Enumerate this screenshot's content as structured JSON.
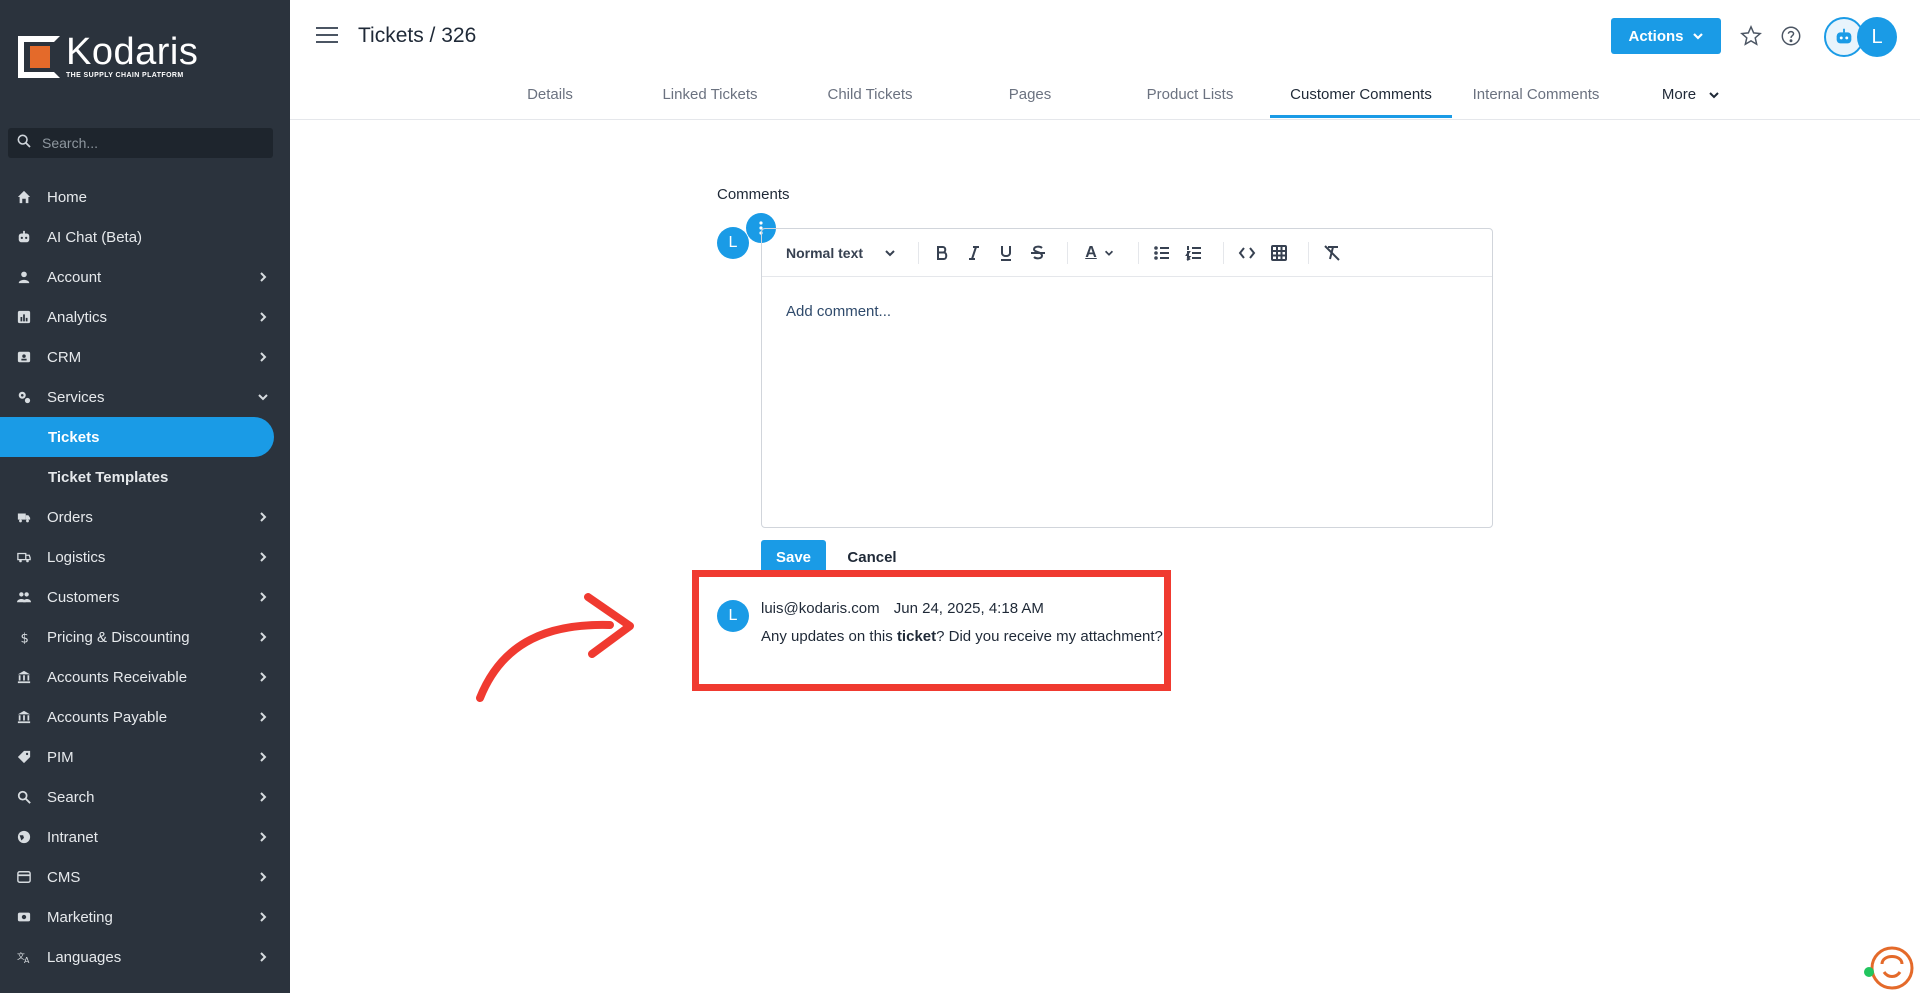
{
  "sidebar": {
    "brand_name": "Kodaris",
    "brand_tagline": "THE SUPPLY CHAIN PLATFORM",
    "search_placeholder": "Search...",
    "items": [
      {
        "label": "Home",
        "icon": "home-icon"
      },
      {
        "label": "AI Chat (Beta)",
        "icon": "robot-icon"
      },
      {
        "label": "Account",
        "icon": "user-icon"
      },
      {
        "label": "Analytics",
        "icon": "analytics-icon"
      },
      {
        "label": "CRM",
        "icon": "contact-card-icon"
      },
      {
        "label": "Services",
        "icon": "services-icon"
      }
    ],
    "services_sub": [
      "Tickets",
      "Ticket Templates"
    ],
    "items_after": [
      {
        "label": "Orders",
        "icon": "truck-icon"
      },
      {
        "label": "Logistics",
        "icon": "shipping-icon"
      },
      {
        "label": "Customers",
        "icon": "people-icon"
      },
      {
        "label": "Pricing & Discounting",
        "icon": "dollar-icon"
      },
      {
        "label": "Accounts Receivable",
        "icon": "bank-icon"
      },
      {
        "label": "Accounts Payable",
        "icon": "bank-icon"
      },
      {
        "label": "PIM",
        "icon": "tag-icon"
      },
      {
        "label": "Search",
        "icon": "search-icon"
      },
      {
        "label": "Intranet",
        "icon": "globe-icon"
      },
      {
        "label": "CMS",
        "icon": "cms-icon"
      },
      {
        "label": "Marketing",
        "icon": "megaphone-icon"
      },
      {
        "label": "Languages",
        "icon": "translate-icon"
      }
    ]
  },
  "header": {
    "title": "Tickets / 326",
    "actions_label": "Actions",
    "user_initial": "L"
  },
  "tabs": [
    {
      "label": "Details"
    },
    {
      "label": "Linked Tickets"
    },
    {
      "label": "Child Tickets"
    },
    {
      "label": "Pages"
    },
    {
      "label": "Product Lists"
    },
    {
      "label": "Customer Comments"
    },
    {
      "label": "Internal Comments"
    },
    {
      "label": "More"
    }
  ],
  "comments": {
    "section_label": "Comments",
    "avatar_initial": "L",
    "editor": {
      "format_label": "Normal text",
      "placeholder": "Add comment...",
      "text_color_glyph": "A"
    },
    "save_label": "Save",
    "cancel_label": "Cancel",
    "entry": {
      "author": "luis@kodaris.com",
      "date": "Jun 24, 2025, 4:18 AM",
      "text_before": "Any updates on this ",
      "text_bold": "ticket",
      "text_after": "? Did you receive my attachment?",
      "avatar_initial": "L"
    }
  },
  "colors": {
    "accent": "#1a9be6",
    "sidebar_bg": "#2b333d",
    "highlight": "#f03a30"
  }
}
